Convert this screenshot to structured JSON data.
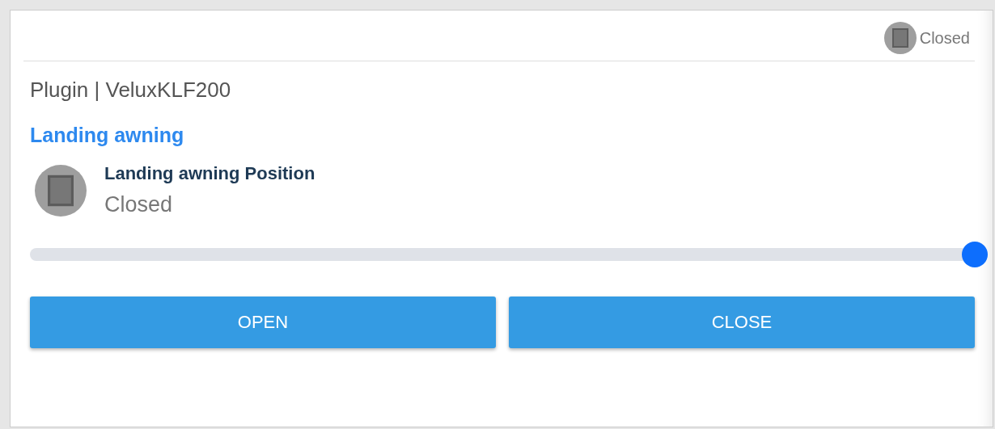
{
  "header": {
    "status": "Closed"
  },
  "title": "Plugin | VeluxKLF200",
  "group": "Landing awning",
  "item": {
    "name": "Landing awning Position",
    "value": "Closed"
  },
  "slider": {
    "level": 1
  },
  "buttons": [
    "OPEN",
    "CLOSE"
  ]
}
